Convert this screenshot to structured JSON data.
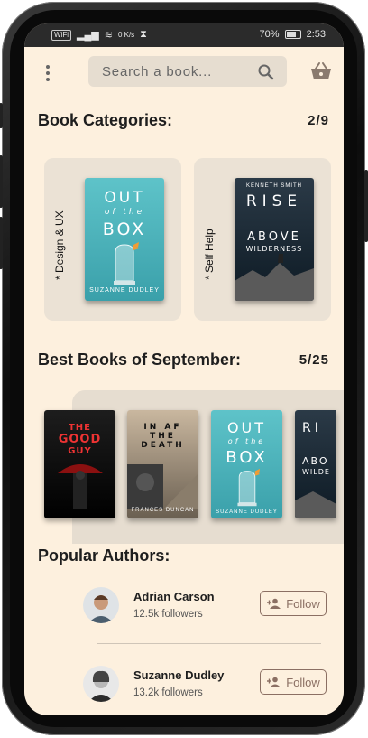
{
  "status_bar": {
    "left_chip": "WiFi",
    "speed": "0 K/s",
    "battery": "70%",
    "time": "2:53"
  },
  "search": {
    "placeholder": "Search a book..."
  },
  "icons": {
    "menu": "menu-dots-icon",
    "search": "search-icon",
    "basket": "basket-icon",
    "follow": "person-add-icon"
  },
  "categories": {
    "title": "Book Categories:",
    "counter": "2/9",
    "items": [
      {
        "label": "* Design & UX",
        "book": {
          "title_lines": [
            "OUT",
            "of the",
            "BOX"
          ],
          "author": "SUZANNE DUDLEY"
        }
      },
      {
        "label": "* Self Help",
        "book": {
          "top": "KENNETH SMITH",
          "title_lines": [
            "RISE",
            "ABOVE",
            "WILDERNESS"
          ]
        }
      }
    ]
  },
  "best_books": {
    "title": "Best Books of September:",
    "counter": "5/25",
    "items": [
      {
        "title_lines": [
          "THE",
          "GOOD",
          "GUY"
        ]
      },
      {
        "title_lines": [
          "IN AF",
          "THE",
          "DEATH"
        ],
        "author": "FRANCES DUNCAN"
      },
      {
        "title_lines": [
          "OUT",
          "of the",
          "BOX"
        ],
        "author": "SUZANNE DUDLEY"
      },
      {
        "title_lines": [
          "RI",
          "ABO",
          "WILDE"
        ]
      }
    ]
  },
  "authors": {
    "title": "Popular Authors:",
    "items": [
      {
        "name": "Adrian Carson",
        "followers": "12.5k followers",
        "button": "Follow"
      },
      {
        "name": "Suzanne Dudley",
        "followers": "13.2k followers",
        "button": "Follow"
      }
    ]
  },
  "colors": {
    "background": "#fdf0de",
    "panel": "#e6ddd0",
    "accent": "#8b6f63"
  }
}
